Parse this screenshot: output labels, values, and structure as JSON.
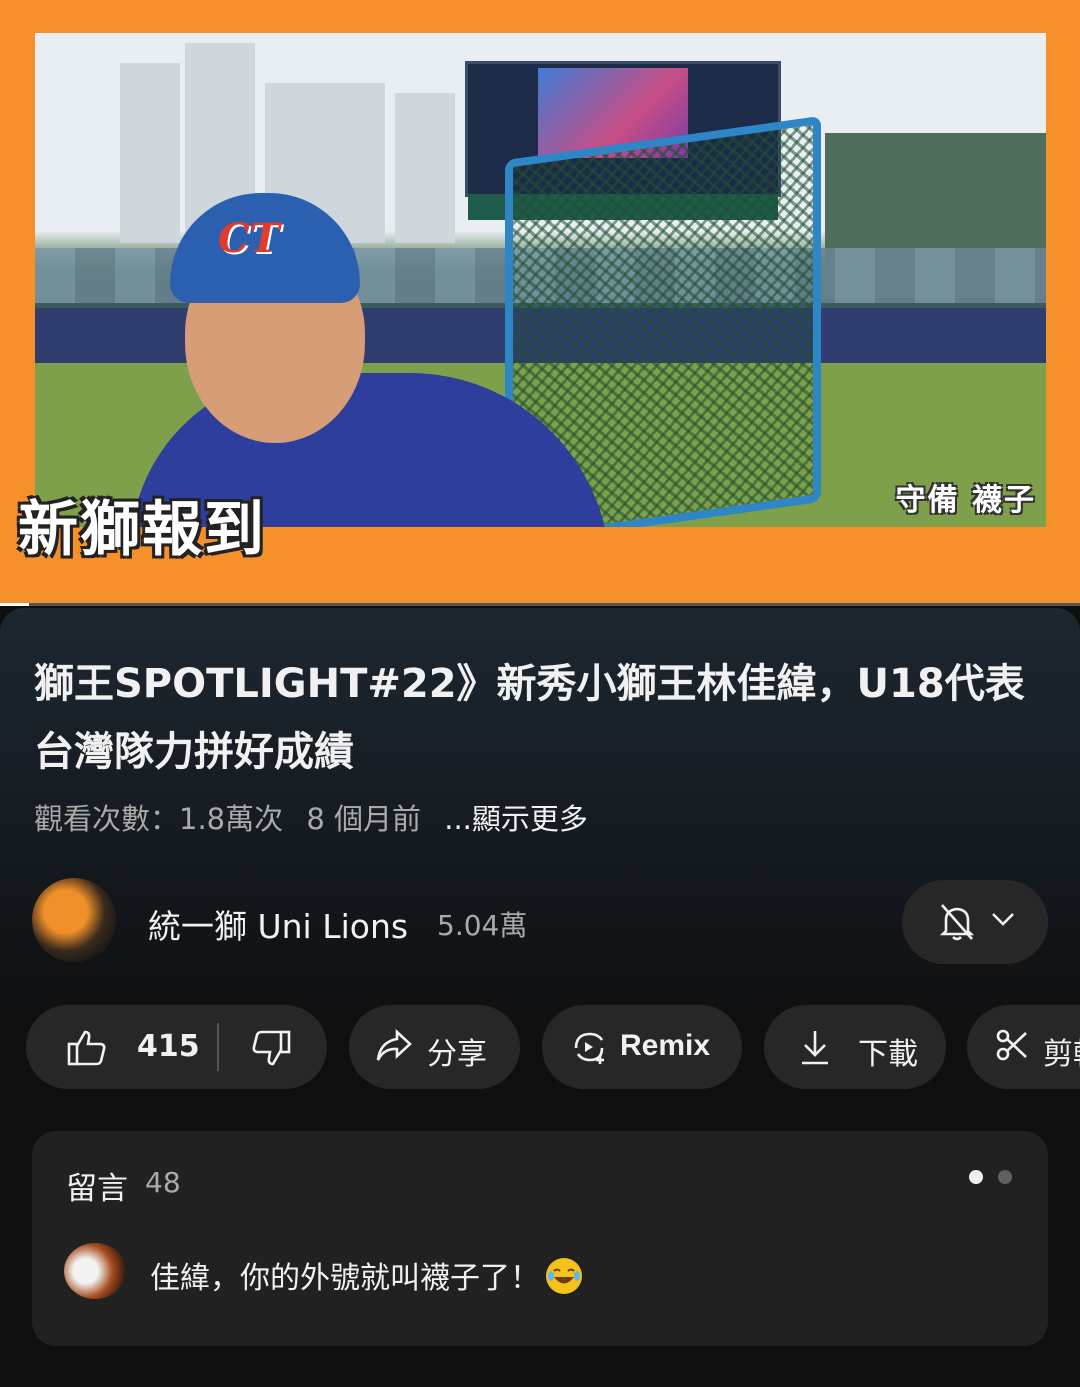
{
  "video": {
    "caption": "守備 襪子",
    "banner": "新獅報到",
    "progress_fraction": 0.027
  },
  "title": "獅王SPOTLIGHT#22》新秀小獅王林佳緯，U18代表台灣隊力拼好成績",
  "meta": {
    "views": "觀看次數：1.8萬次",
    "age": "8 個月前",
    "more": "...顯示更多"
  },
  "channel": {
    "name": "統一獅 Uni Lions",
    "subscribers": "5.04萬"
  },
  "actions": {
    "like_count": "415",
    "share": "分享",
    "remix": "Remix",
    "download": "下載",
    "clip": "剪輯"
  },
  "comments": {
    "heading": "留言",
    "count": "48",
    "top_comment": "佳緯，你的外號就叫襪子了！",
    "emoji": "face-with-tears-of-joy"
  },
  "colors": {
    "accent_orange": "#f5902a",
    "background": "#0f0f0f",
    "pill": "#272727"
  }
}
